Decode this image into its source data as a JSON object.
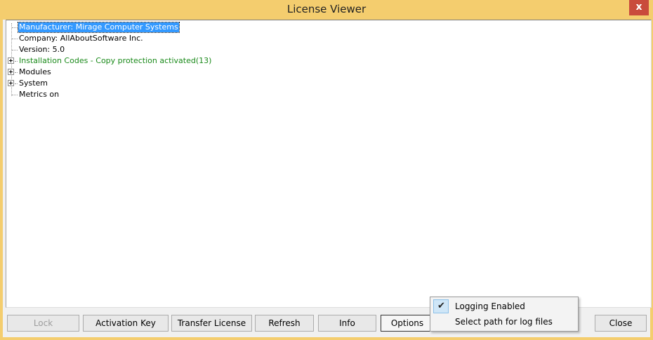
{
  "window": {
    "title": "License Viewer",
    "close_glyph": "x"
  },
  "tree": {
    "items": [
      {
        "label": "Manufacturer: Mirage Computer Systems",
        "expandable": false,
        "selected": true,
        "color": "#ffffff"
      },
      {
        "label": "Company: AllAboutSoftware Inc.",
        "expandable": false,
        "selected": false
      },
      {
        "label": "Version: 5.0",
        "expandable": false,
        "selected": false
      },
      {
        "label": "Installation Codes - Copy protection activated(13)",
        "expandable": true,
        "selected": false,
        "color": "#1a8a1a"
      },
      {
        "label": "Modules",
        "expandable": true,
        "selected": false
      },
      {
        "label": "System",
        "expandable": true,
        "selected": false
      },
      {
        "label": "Metrics on",
        "expandable": false,
        "selected": false
      }
    ]
  },
  "buttons": {
    "lock": "Lock",
    "activation_key": "Activation Key",
    "transfer_license": "Transfer License",
    "refresh": "Refresh",
    "info": "Info",
    "options": "Options",
    "close": "Close"
  },
  "options_menu": {
    "items": [
      {
        "label": "Logging Enabled",
        "checked": true
      },
      {
        "label": "Select path for log files",
        "checked": false
      }
    ]
  },
  "colors": {
    "title_bar": "#f4cd6e",
    "selection": "#3399ff",
    "green_text": "#1a8a1a"
  }
}
